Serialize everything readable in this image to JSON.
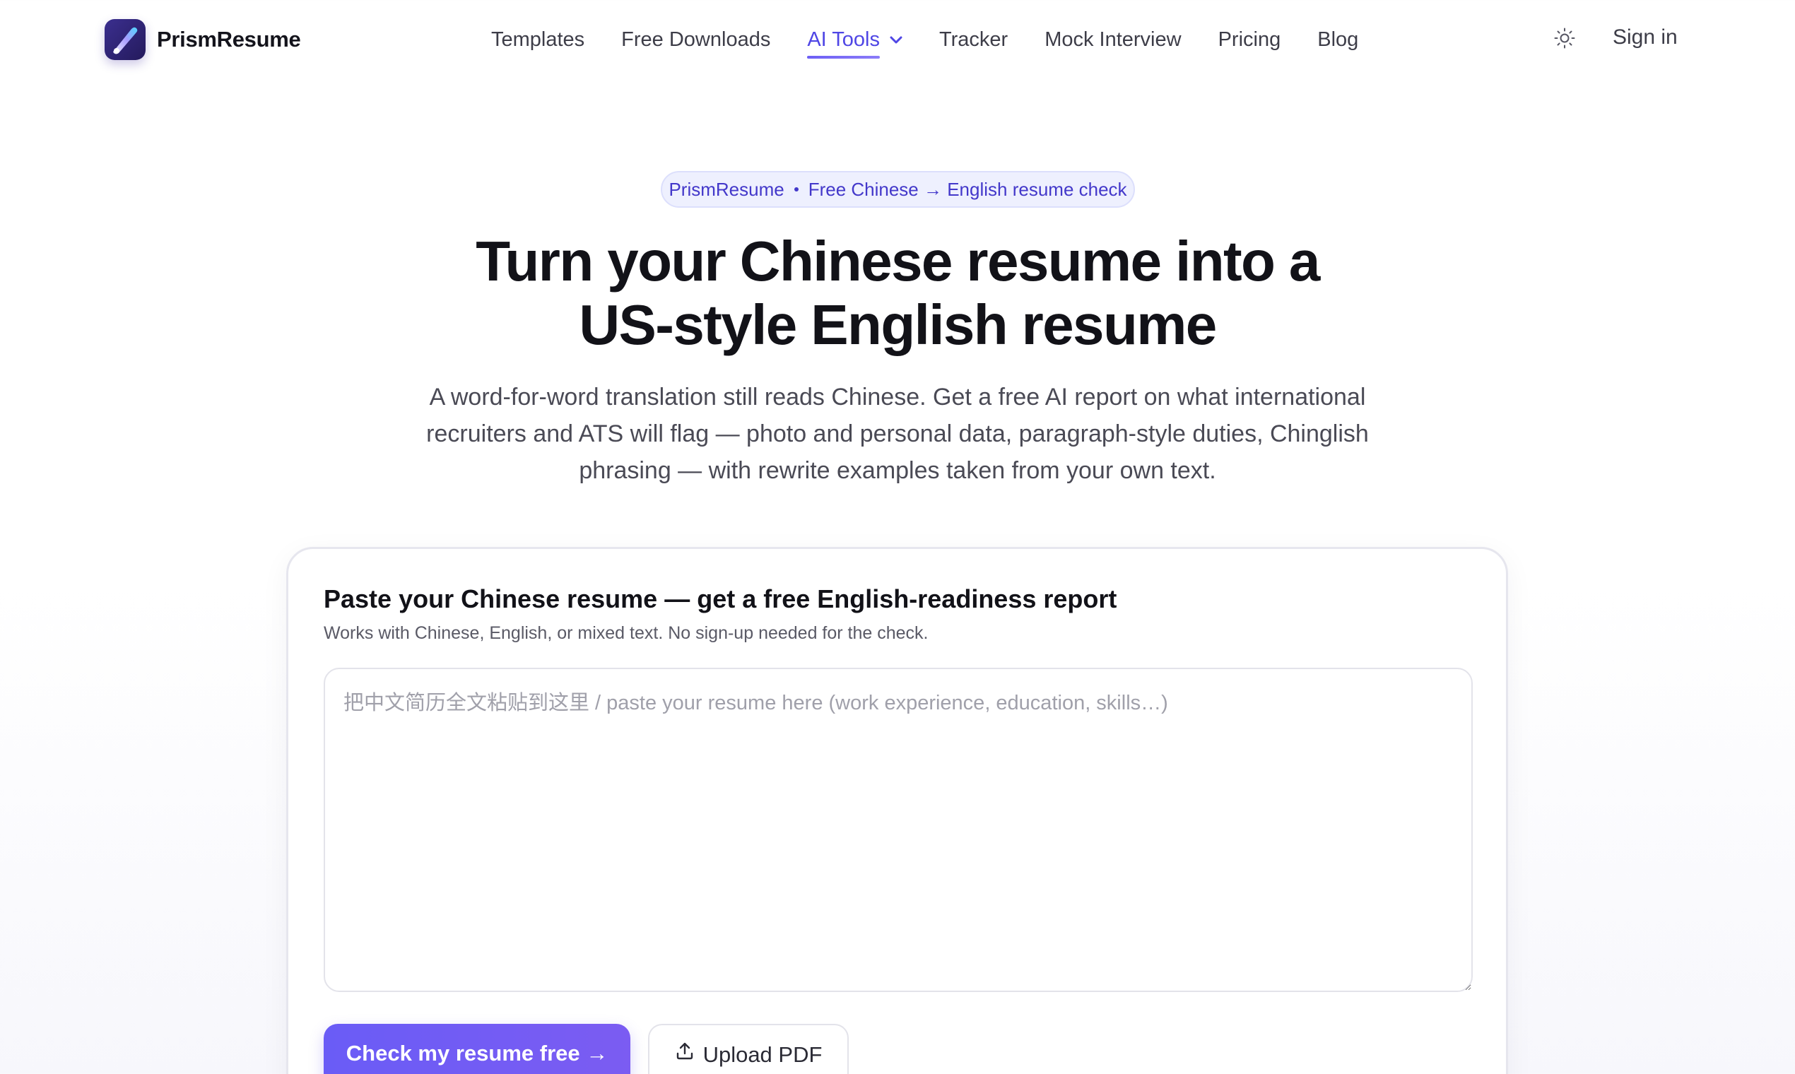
{
  "brand": {
    "name": "PrismResume"
  },
  "nav": {
    "items": [
      {
        "label": "Templates"
      },
      {
        "label": "Free Downloads"
      },
      {
        "label": "AI Tools",
        "active": true,
        "has_dropdown": true
      },
      {
        "label": "Tracker"
      },
      {
        "label": "Mock Interview"
      },
      {
        "label": "Pricing"
      },
      {
        "label": "Blog"
      }
    ],
    "theme_icon": "sun-icon",
    "signin_label": "Sign in"
  },
  "hero": {
    "pill_brand": "PrismResume",
    "pill_text": "Free Chinese → English resume check",
    "title_line1": "Turn your Chinese resume into a",
    "title_line2": "US-style English resume",
    "subtitle": "A word-for-word translation still reads Chinese. Get a free AI report on what international recruiters and ATS will flag — photo and personal data, paragraph-style duties, Chinglish phrasing — with rewrite examples taken from your own text."
  },
  "card": {
    "title": "Paste your Chinese resume — get a free English-readiness report",
    "subtitle": "Works with Chinese, English, or mixed text. No sign-up needed for the check.",
    "textarea_placeholder": "把中文简历全文粘贴到这里 / paste your resume here (work experience, education, skills…)",
    "textarea_value": "",
    "primary_button": "Check my resume free →",
    "secondary_button": "Upload PDF",
    "secondary_icon": "upload-icon"
  },
  "colors": {
    "accent": "#4f46e5",
    "button_gradient_start": "#6a5cf6",
    "button_gradient_end": "#7b5cf2",
    "pill_bg": "#eef0fe",
    "pill_text": "#4338ca"
  }
}
